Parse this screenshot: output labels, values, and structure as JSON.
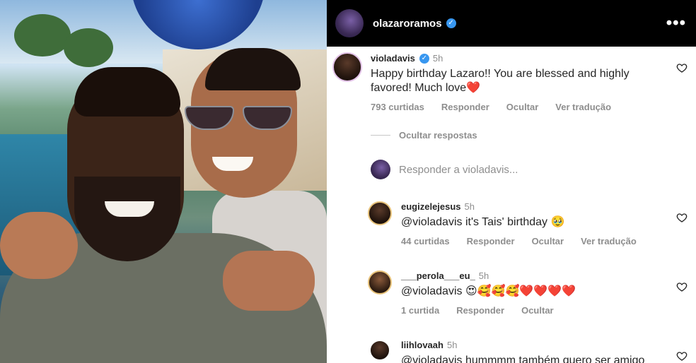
{
  "post_header": {
    "username": "olazaroramos",
    "verified": true,
    "more_icon": "more-horizontal-icon"
  },
  "comments": [
    {
      "username": "violadavis",
      "verified": true,
      "time": "5h",
      "text": "Happy birthday Lazaro!! You are blessed and highly favored! Much love",
      "emoji": "❤️",
      "likes": "793 curtidas",
      "reply": "Responder",
      "hide": "Ocultar",
      "translate": "Ver tradução"
    },
    {
      "username": "eugizelejesus",
      "time": "5h",
      "text": "@violadavis it's Tais' birthday 🥹",
      "likes": "44 curtidas",
      "reply": "Responder",
      "hide": "Ocultar",
      "translate": "Ver tradução"
    },
    {
      "username": "___perola___eu_",
      "time": "5h",
      "text": "@violadavis 😍🥰🥰🥰❤️❤️❤️❤️",
      "likes": "1 curtida",
      "reply": "Responder",
      "hide": "Ocultar"
    },
    {
      "username": "liihlovaah",
      "time": "5h",
      "text": "@violadavis hummmm também quero ser amigo"
    }
  ],
  "hide_replies_label": "Ocultar respostas",
  "reply_placeholder": "Responder a violadavis...",
  "colors": {
    "header_bg": "#000000",
    "verified_blue": "#3897f0",
    "meta_gray": "#8e8e8e",
    "text_dark": "#262626"
  }
}
